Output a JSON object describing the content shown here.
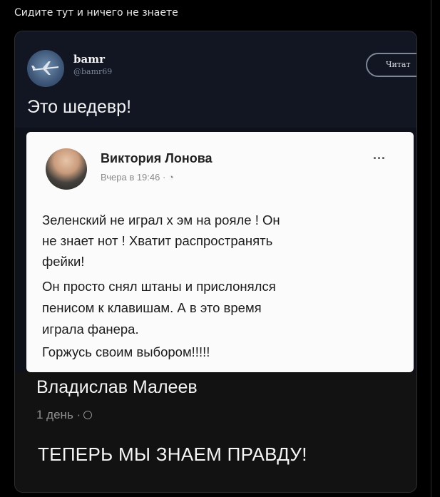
{
  "post": {
    "caption": "Сидите тут и ничего не знаете"
  },
  "tweet": {
    "author_name": "bamr",
    "author_handle": "@bamr69",
    "follow_label": "Читат",
    "text": "Это шедевр!"
  },
  "fb_post": {
    "author_name": "Виктория Лонова",
    "meta": "Вчера в 19:46 ·",
    "more_label": "...",
    "lines": [
      "Зеленский не играл х   эм на рояле ! Он",
      "не знает нот ! Хватит распространять",
      "фейки!",
      "Он просто снял штаны и прислонялся",
      "пенисом к клавишам. А в это время",
      "играла фанера.",
      "Горжусь своим выбором!!!!!"
    ]
  },
  "comment": {
    "author_name": "Владислав Малеев",
    "meta": "1 день ·",
    "text": "ТЕПЕРЬ МЫ ЗНАЕМ ПРАВДУ!"
  },
  "colors": {
    "background": "#000000",
    "tweet_bg": "#121623",
    "card_bg": "#fbfbfb",
    "text": "#ffffff"
  }
}
